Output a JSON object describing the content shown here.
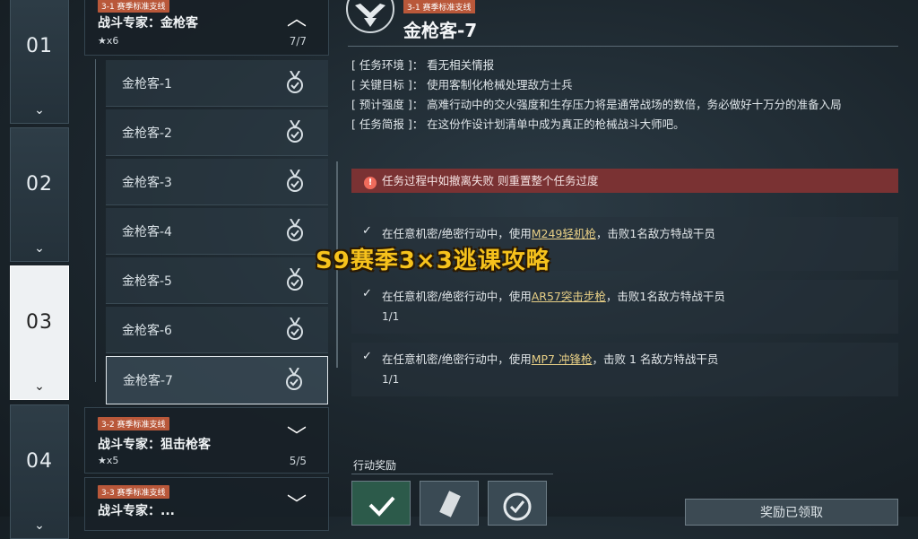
{
  "rail": [
    {
      "num": "01",
      "active": false
    },
    {
      "num": "02",
      "active": false
    },
    {
      "num": "03",
      "active": true
    },
    {
      "num": "04",
      "active": false
    }
  ],
  "groups": [
    {
      "tag": "3-1 赛季标准支线",
      "title": "战斗专家：金枪客",
      "stars": "★x6",
      "count": "7/7",
      "expanded": true
    },
    {
      "tag": "3-2 赛季标准支线",
      "title": "战斗专家：狙击枪客",
      "stars": "★x5",
      "count": "5/5",
      "expanded": false
    },
    {
      "tag": "3-3 赛季标准支线",
      "title": "战斗专家：...",
      "stars": "",
      "count": "",
      "expanded": false
    }
  ],
  "quests": [
    "金枪客-1",
    "金枪客-2",
    "金枪客-3",
    "金枪客-4",
    "金枪客-5",
    "金枪客-6",
    "金枪客-7"
  ],
  "selected_quest_index": 6,
  "detail": {
    "tag": "3-1 赛季标准支线",
    "title": "金枪客-7",
    "info": [
      "[ 任务环境 ]：  看无相关情报",
      "[ 关键目标 ]：  使用客制化枪械处理敌方士兵",
      "[ 预计强度 ]：  高难行动中的交火强度和生存压力将是通常战场的数倍，务必做好十万分的准备入局",
      "[ 任务简报 ]：  在这份作设计划清单中成为真正的枪械战斗大师吧。"
    ],
    "warning": "任务过程中如撤离失败 则重置整个任务过度",
    "objectives": [
      {
        "prefix": "在任意机密/绝密行动中，使用",
        "weapon": "M249轻机枪",
        "suffix": "，击败1名敌方特战干员",
        "progress": ""
      },
      {
        "prefix": "在任意机密/绝密行动中，使用",
        "weapon": "AR57突击步枪",
        "suffix": "，击败1名敌方特战干员",
        "progress": "1/1"
      },
      {
        "prefix": "在任意机密/绝密行动中，使用",
        "weapon": "MP7 冲锋枪",
        "suffix": "，击败 1 名敌方特战干员",
        "progress": "1/1"
      }
    ],
    "reward_label": "行动奖励",
    "claim_label": "奖励已领取"
  },
  "overlay_text": "S9赛季3×3逃课攻略"
}
